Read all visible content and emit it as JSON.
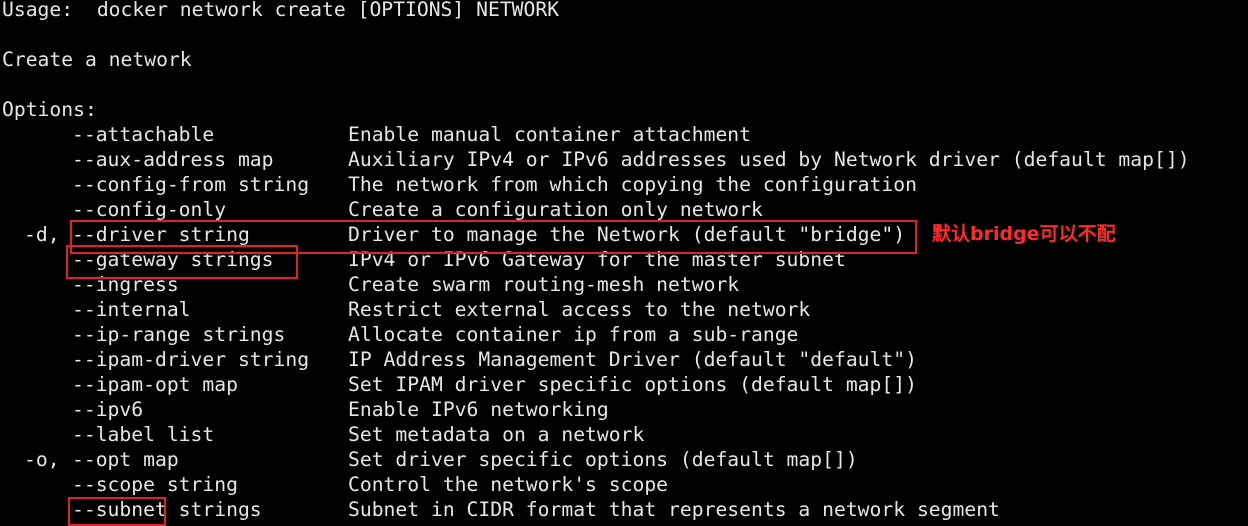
{
  "terminal": {
    "usage": "Usage:  docker network create [OPTIONS] NETWORK",
    "description": "Create a network",
    "options_header": "Options:",
    "options": [
      {
        "short": "",
        "flag": "--attachable",
        "desc": "Enable manual container attachment"
      },
      {
        "short": "",
        "flag": "--aux-address map",
        "desc": "Auxiliary IPv4 or IPv6 addresses used by Network driver (default map[])"
      },
      {
        "short": "",
        "flag": "--config-from string",
        "desc": "The network from which copying the configuration"
      },
      {
        "short": "",
        "flag": "--config-only",
        "desc": "Create a configuration only network"
      },
      {
        "short": "-d,",
        "flag": "--driver string",
        "desc": "Driver to manage the Network (default \"bridge\")"
      },
      {
        "short": "",
        "flag": "--gateway strings",
        "desc": "IPv4 or IPv6 Gateway for the master subnet"
      },
      {
        "short": "",
        "flag": "--ingress",
        "desc": "Create swarm routing-mesh network"
      },
      {
        "short": "",
        "flag": "--internal",
        "desc": "Restrict external access to the network"
      },
      {
        "short": "",
        "flag": "--ip-range strings",
        "desc": "Allocate container ip from a sub-range"
      },
      {
        "short": "",
        "flag": "--ipam-driver string",
        "desc": "IP Address Management Driver (default \"default\")"
      },
      {
        "short": "",
        "flag": "--ipam-opt map",
        "desc": "Set IPAM driver specific options (default map[])"
      },
      {
        "short": "",
        "flag": "--ipv6",
        "desc": "Enable IPv6 networking"
      },
      {
        "short": "",
        "flag": "--label list",
        "desc": "Set metadata on a network"
      },
      {
        "short": "-o,",
        "flag": "--opt map",
        "desc": "Set driver specific options (default map[])"
      },
      {
        "short": "",
        "flag": "--scope string",
        "desc": "Control the network's scope"
      },
      {
        "short": "",
        "flag": "--subnet strings",
        "desc": "Subnet in CIDR format that represents a network segment"
      }
    ]
  },
  "annotation": {
    "text": "默认bridge可以不配",
    "color": "#ff2a2a"
  },
  "highlight_color": "#e0202a"
}
